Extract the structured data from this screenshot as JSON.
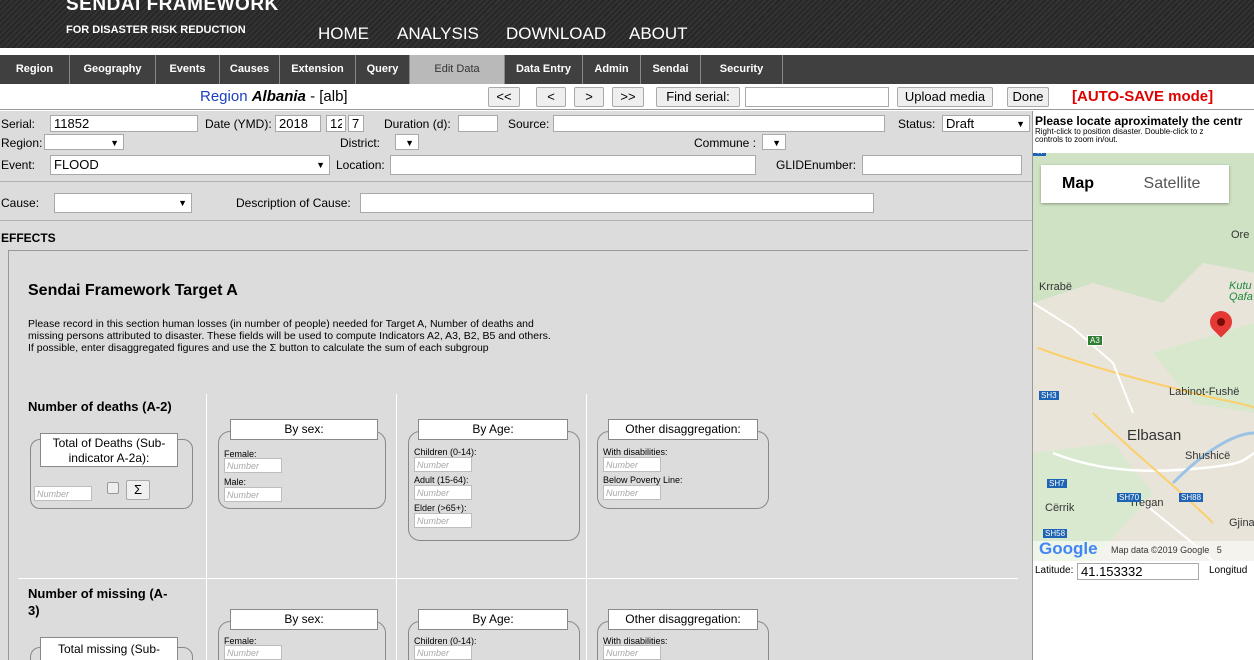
{
  "header": {
    "brand_line1": "SENDAI FRAMEWORK",
    "brand_line2": "FOR DISASTER RISK REDUCTION",
    "nav": [
      "HOME",
      "ANALYSIS",
      "DOWNLOAD",
      "ABOUT"
    ]
  },
  "tabs": [
    "Region",
    "Geography",
    "Events",
    "Causes",
    "Extension",
    "Query",
    "Edit Data",
    "Data Entry",
    "Admin",
    "Sendai",
    "Security"
  ],
  "active_tab": "Edit Data",
  "toolbar": {
    "region_word": "Region",
    "region_name": "Albania",
    "region_code": "- [alb]",
    "first": "<<",
    "prev": "<",
    "next": ">",
    "last": ">>",
    "find_serial": "Find serial:",
    "upload_media": "Upload media",
    "done": "Done",
    "autosave": "[AUTO-SAVE mode]"
  },
  "form": {
    "serial_label": "Serial:",
    "serial_value": "11852",
    "date_label": "Date (YMD):",
    "year": "2018",
    "month": "12",
    "day": "7",
    "duration_label": "Duration (d):",
    "source_label": "Source:",
    "status_label": "Status:",
    "status_value": "Draft",
    "region_label": "Region:",
    "district_label": "District:",
    "commune_label": "Commune :",
    "event_label": "Event:",
    "event_value": "FLOOD",
    "location_label": "Location:",
    "glide_label": "GLIDEnumber:",
    "cause_label": "Cause:",
    "cause_desc_label": "Description of Cause:",
    "effects_label": "EFFECTS"
  },
  "target": {
    "title": "Sendai Framework Target A",
    "desc1": "Please record in this section human losses (in number of people) needed for Target A, Number of deaths and",
    "desc2": "missing persons attributed to disaster. These fields will be used to compute Indicators A2, A3, B2, B5 and others.",
    "desc3": "If possible, enter disaggregated figures and use the Σ button to calculate the sum of each subgroup",
    "deaths_title": "Number of deaths (A-2)",
    "deaths_total_title": "Total of Deaths (Sub-indicator A-2a):",
    "missing_title_1": "Number of missing (A-",
    "missing_title_2": "3)",
    "missing_total_title": "Total missing (Sub-",
    "by_sex": "By sex:",
    "by_age": "By Age:",
    "other": "Other disaggregation:",
    "female": "Female:",
    "male": "Male:",
    "children": "Children (0-14):",
    "adult": "Adult (15-64):",
    "elder": "Elder (>65+):",
    "disabilities": "With disabilities:",
    "poverty": "Below Poverty Line:",
    "number_placeholder": "Number",
    "sigma": "Σ"
  },
  "map": {
    "instruction_title": "Please locate aproximately the centr",
    "instruction_text1": "Right-click to position disaster. Double-click to z",
    "instruction_text2": "controls to zoom in/out.",
    "tab_map": "Map",
    "tab_satellite": "Satellite",
    "places": [
      "Ore",
      "Kutu",
      "Qafa",
      "Krrabë",
      "Labinot-Fushë",
      "Elbasan",
      "Shushicë",
      "Cërrik",
      "Tregan",
      "Gjina"
    ],
    "roads": [
      "A3",
      "SH3",
      "SH7",
      "SH70",
      "SH88",
      "SH58",
      "47"
    ],
    "google": "Google",
    "attribution": "Map data ©2019 Google   5",
    "latitude_label": "Latitude:",
    "latitude_value": "41.153332",
    "longitude_label": "Longitud"
  }
}
